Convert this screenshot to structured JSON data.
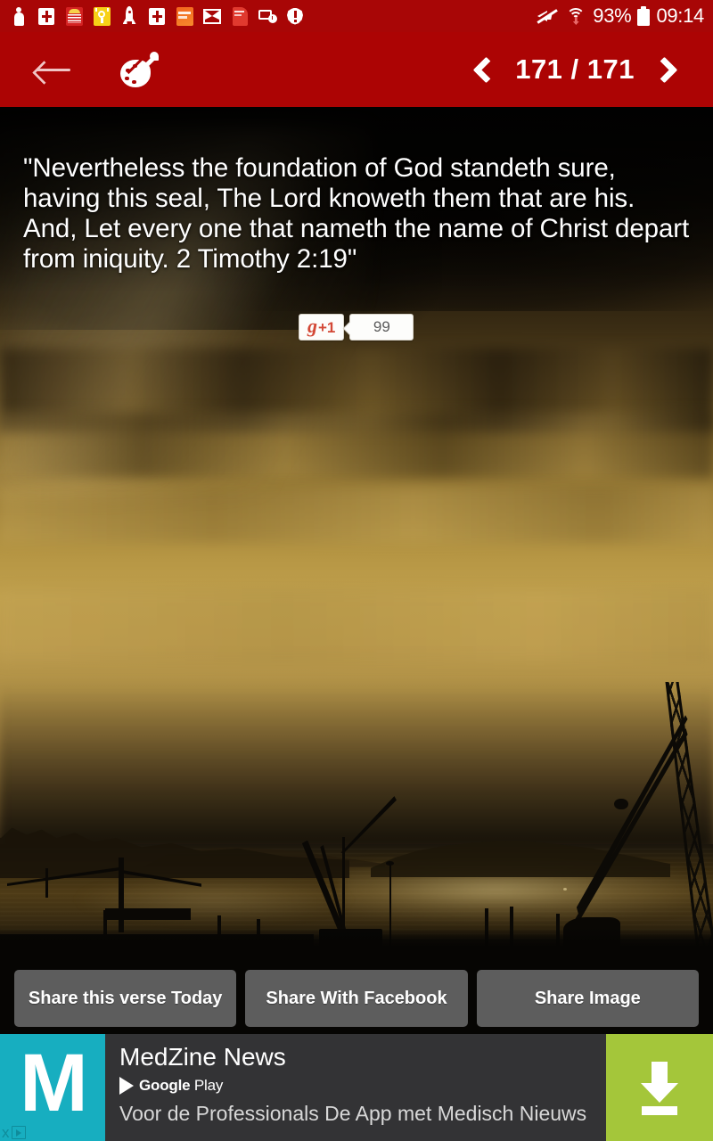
{
  "status_bar": {
    "battery_percent": "93%",
    "time": "09:14",
    "notification_icons": [
      "person-icon",
      "bible-book-icon",
      "jesus-speaks-app-icon",
      "prayer-app-icon",
      "rocket-icon",
      "bible-book-icon",
      "daily-scripture-app-icon",
      "gmail-icon",
      "red-book-app-icon",
      "screen-clock-icon",
      "warning-icon"
    ],
    "right_icons": [
      "mute-icon",
      "wifi-icon",
      "battery-icon"
    ]
  },
  "action_bar": {
    "back_label": "",
    "palette_label": "",
    "prev_label": "",
    "next_label": "",
    "counter": "171 / 171",
    "current_page": 171,
    "total_pages": 171,
    "background_color": "#AC0404"
  },
  "verse": {
    "text": "\"Nevertheless the foundation of God standeth sure, having this seal, The Lord knoweth them that are his. And, Let every one that nameth the name of Christ depart from iniquity. 2 Timothy 2:19\"",
    "reference": "2 Timothy 2:19"
  },
  "gplus": {
    "label": "+1",
    "g_letter": "g",
    "count": "99"
  },
  "share_buttons": [
    {
      "label": "Share this verse Today",
      "name": "share-verse-button"
    },
    {
      "label": "Share With Facebook",
      "name": "share-facebook-button"
    },
    {
      "label": "Share Image",
      "name": "share-image-button"
    }
  ],
  "ad": {
    "logo_letter": "M",
    "title": "MedZine News",
    "store_brand": "Google",
    "store_suffix": "Play",
    "description": "Voor de Professionals De App met Medisch Nieuws",
    "close_label": "x",
    "cta_label": "",
    "logo_color": "#17AEC0",
    "cta_color": "#A4C63A",
    "background_color": "#333335"
  },
  "theme": {
    "status_bar_color": "#A80606",
    "action_bar_color": "#AC0404",
    "share_button_color": "#5D5D5D",
    "gplus_red": "#D34836"
  }
}
